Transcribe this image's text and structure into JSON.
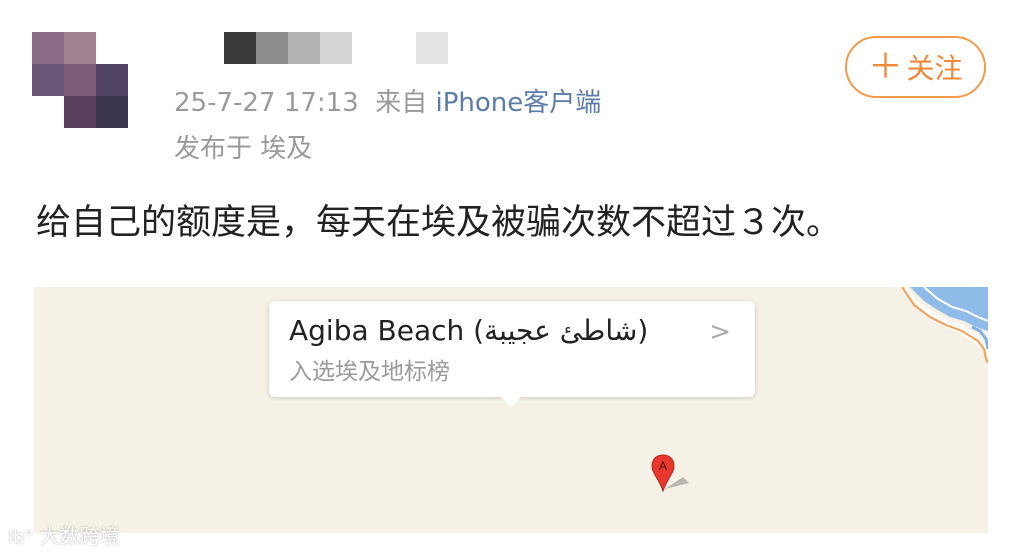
{
  "post": {
    "timestamp": "25-7-27 17:13",
    "via": "来自",
    "client": "iPhone客户端",
    "location": "发布于 埃及",
    "text": "给自己的额度是，每天在埃及被骗次数不超过３次。",
    "follow_label": "关注",
    "follow_icon": "plus-icon"
  },
  "map": {
    "place_name": "Agiba Beach (شاطئ عجيبة)",
    "subtitle": "入选埃及地标榜",
    "marker_letter": "A",
    "colors": {
      "background": "#f6f1e6",
      "water": "#7bb1e6",
      "border_line": "#f0a05a",
      "marker": "#e8372c"
    }
  },
  "watermark": {
    "logo": "lb°",
    "text": "大数跨境"
  },
  "colors": {
    "accent": "#f0883a",
    "link": "#5b7ca8",
    "meta": "#9a9a9a",
    "body_text": "#222222"
  }
}
